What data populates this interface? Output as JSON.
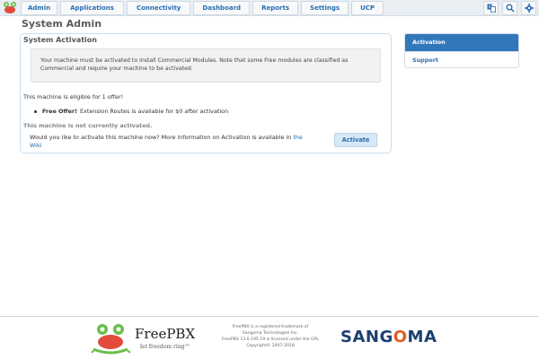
{
  "nav": {
    "items": [
      "Admin",
      "Applications",
      "Connectivity",
      "Dashboard",
      "Reports",
      "Settings",
      "UCP"
    ]
  },
  "page": {
    "title": "System Admin"
  },
  "card": {
    "title": "System Activation",
    "alert_line1": "Your machine must be activated to install Commercial Modules. Note that some Free modules are classified as",
    "alert_line2": "Commercial and require your machine to be activated.",
    "eligible": "This machine is eligible for 1 offer!",
    "offer_label": "Free Offer!",
    "offer_text": "Extension Routes is available for $0 after activation",
    "not_activated": "This machine is not currently activated.",
    "question_text": "Would you like to activate this machine now? More information on Activation is available in",
    "question_link_the": "the",
    "question_link_wiki": "Wiki",
    "activate_button": "Activate"
  },
  "sidebar": {
    "items": [
      {
        "label": "Activation",
        "active": true
      },
      {
        "label": "Support",
        "active": false
      }
    ]
  },
  "footer": {
    "freepbx_word": "FreePBX",
    "freepbx_tagline": "let freedom ring™",
    "legal_lines": [
      "FreePBX is a registered trademark of",
      "Sangoma Technologies Inc.",
      "FreePBX 13.0.195.19 is licensed under the GPL",
      "Copyright© 2007-2018"
    ],
    "sangoma_left": "SANG",
    "sangoma_o": "O",
    "sangoma_right": "MA"
  },
  "colors": {
    "accent": "#2a6db0",
    "active_menu": "#3377bb",
    "sangoma_blue": "#1d3f72",
    "sangoma_orange": "#e35b21"
  },
  "icons": [
    "freepbx-frog-icon",
    "translate-icon",
    "search-icon",
    "gear-icon"
  ]
}
